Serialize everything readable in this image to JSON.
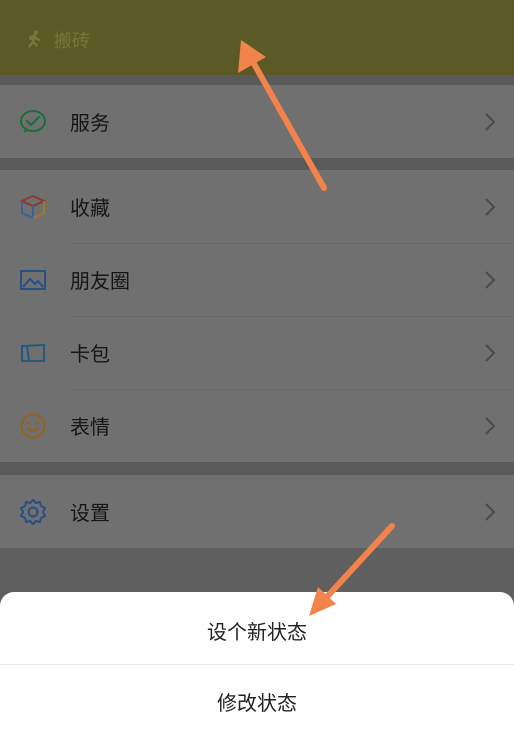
{
  "status": {
    "label": "搬砖",
    "icon": "running-person-icon"
  },
  "menu": {
    "service": {
      "label": "服务",
      "icon": "service-icon"
    },
    "favorites": {
      "label": "收藏",
      "icon": "cube-icon"
    },
    "moments": {
      "label": "朋友圈",
      "icon": "image-icon"
    },
    "cards": {
      "label": "卡包",
      "icon": "card-icon"
    },
    "stickers": {
      "label": "表情",
      "icon": "smile-icon"
    },
    "settings": {
      "label": "设置",
      "icon": "gear-icon"
    }
  },
  "sheet": {
    "set_new_status": "设个新状态",
    "modify_status": "修改状态"
  },
  "colors": {
    "status_bar_bg": "#5b5a26",
    "overlay_bg": "#5f5f5f",
    "annotation_arrow": "#f1834b"
  }
}
